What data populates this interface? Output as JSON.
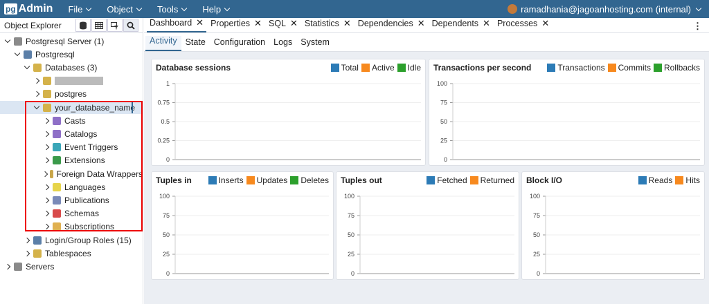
{
  "brand": {
    "pg": "pg",
    "admin": "Admin"
  },
  "menu": [
    "File",
    "Object",
    "Tools",
    "Help"
  ],
  "user": {
    "label": "ramadhania@jagoanhosting.com (internal)"
  },
  "object_explorer": {
    "title": "Object Explorer"
  },
  "tree": [
    {
      "label": "Postgresql Server (1)",
      "indent": 0,
      "state": "open",
      "icon": "server-icon",
      "color": "#8a8a8a"
    },
    {
      "label": "Postgresql",
      "indent": 1,
      "state": "open",
      "icon": "elephant-icon",
      "color": "#5b7fa8"
    },
    {
      "label": "Databases (3)",
      "indent": 2,
      "state": "open",
      "icon": "databases-icon",
      "color": "#d4b24a"
    },
    {
      "label": "",
      "indent": 3,
      "state": "closed",
      "icon": "database-icon",
      "color": "#d4b24a",
      "redacted": true
    },
    {
      "label": "postgres",
      "indent": 3,
      "state": "closed",
      "icon": "database-disconnected-icon",
      "color": "#d4b24a"
    },
    {
      "label": "your_database_name",
      "indent": 3,
      "state": "open",
      "icon": "database-icon",
      "color": "#d4b24a",
      "selected": true
    },
    {
      "label": "Casts",
      "indent": 4,
      "state": "closed",
      "icon": "casts-icon",
      "color": "#8e6fc7"
    },
    {
      "label": "Catalogs",
      "indent": 4,
      "state": "closed",
      "icon": "catalogs-icon",
      "color": "#8e6fc7"
    },
    {
      "label": "Event Triggers",
      "indent": 4,
      "state": "closed",
      "icon": "event-triggers-icon",
      "color": "#3aa6b8"
    },
    {
      "label": "Extensions",
      "indent": 4,
      "state": "closed",
      "icon": "extensions-icon",
      "color": "#3a9a4a"
    },
    {
      "label": "Foreign Data Wrappers",
      "indent": 4,
      "state": "closed",
      "icon": "foreign-data-wrappers-icon",
      "color": "#c9a64a"
    },
    {
      "label": "Languages",
      "indent": 4,
      "state": "closed",
      "icon": "languages-icon",
      "color": "#e6d44a"
    },
    {
      "label": "Publications",
      "indent": 4,
      "state": "closed",
      "icon": "publications-icon",
      "color": "#7a8ab8"
    },
    {
      "label": "Schemas",
      "indent": 4,
      "state": "closed",
      "icon": "schemas-icon",
      "color": "#d84a4a"
    },
    {
      "label": "Subscriptions",
      "indent": 4,
      "state": "closed",
      "icon": "subscriptions-icon",
      "color": "#e0b050"
    },
    {
      "label": "Login/Group Roles (15)",
      "indent": 2,
      "state": "closed",
      "icon": "roles-icon",
      "color": "#5b7fa8"
    },
    {
      "label": "Tablespaces",
      "indent": 2,
      "state": "closed",
      "icon": "tablespaces-icon",
      "color": "#d4b24a"
    },
    {
      "label": "Servers",
      "indent": 0,
      "state": "closed",
      "icon": "servers-icon",
      "color": "#8a8a8a"
    }
  ],
  "tabs": [
    "Dashboard",
    "Properties",
    "SQL",
    "Statistics",
    "Dependencies",
    "Dependents",
    "Processes"
  ],
  "subtabs": [
    "Activity",
    "State",
    "Configuration",
    "Logs",
    "System"
  ],
  "colors": {
    "blue": "#2c7bb6",
    "orange": "#f7891e",
    "green": "#2ca02c"
  },
  "chart_data": [
    {
      "type": "line",
      "title": "Database sessions",
      "legend": [
        "Total",
        "Active",
        "Idle"
      ],
      "yticks": [
        "1",
        "0.75",
        "0.5",
        "0.25",
        "0"
      ],
      "ylim": [
        0,
        1
      ],
      "series": []
    },
    {
      "type": "line",
      "title": "Transactions per second",
      "legend": [
        "Transactions",
        "Commits",
        "Rollbacks"
      ],
      "yticks": [
        "100",
        "75",
        "50",
        "25",
        "0"
      ],
      "ylim": [
        0,
        100
      ],
      "series": []
    },
    {
      "type": "line",
      "title": "Tuples in",
      "legend": [
        "Inserts",
        "Updates",
        "Deletes"
      ],
      "yticks": [
        "100",
        "75",
        "50",
        "25",
        "0"
      ],
      "ylim": [
        0,
        100
      ],
      "series": []
    },
    {
      "type": "line",
      "title": "Tuples out",
      "legend": [
        "Fetched",
        "Returned"
      ],
      "yticks": [
        "100",
        "75",
        "50",
        "25",
        "0"
      ],
      "ylim": [
        0,
        100
      ],
      "series": []
    },
    {
      "type": "line",
      "title": "Block I/O",
      "legend": [
        "Reads",
        "Hits"
      ],
      "yticks": [
        "100",
        "75",
        "50",
        "25",
        "0"
      ],
      "ylim": [
        0,
        100
      ],
      "series": []
    }
  ]
}
